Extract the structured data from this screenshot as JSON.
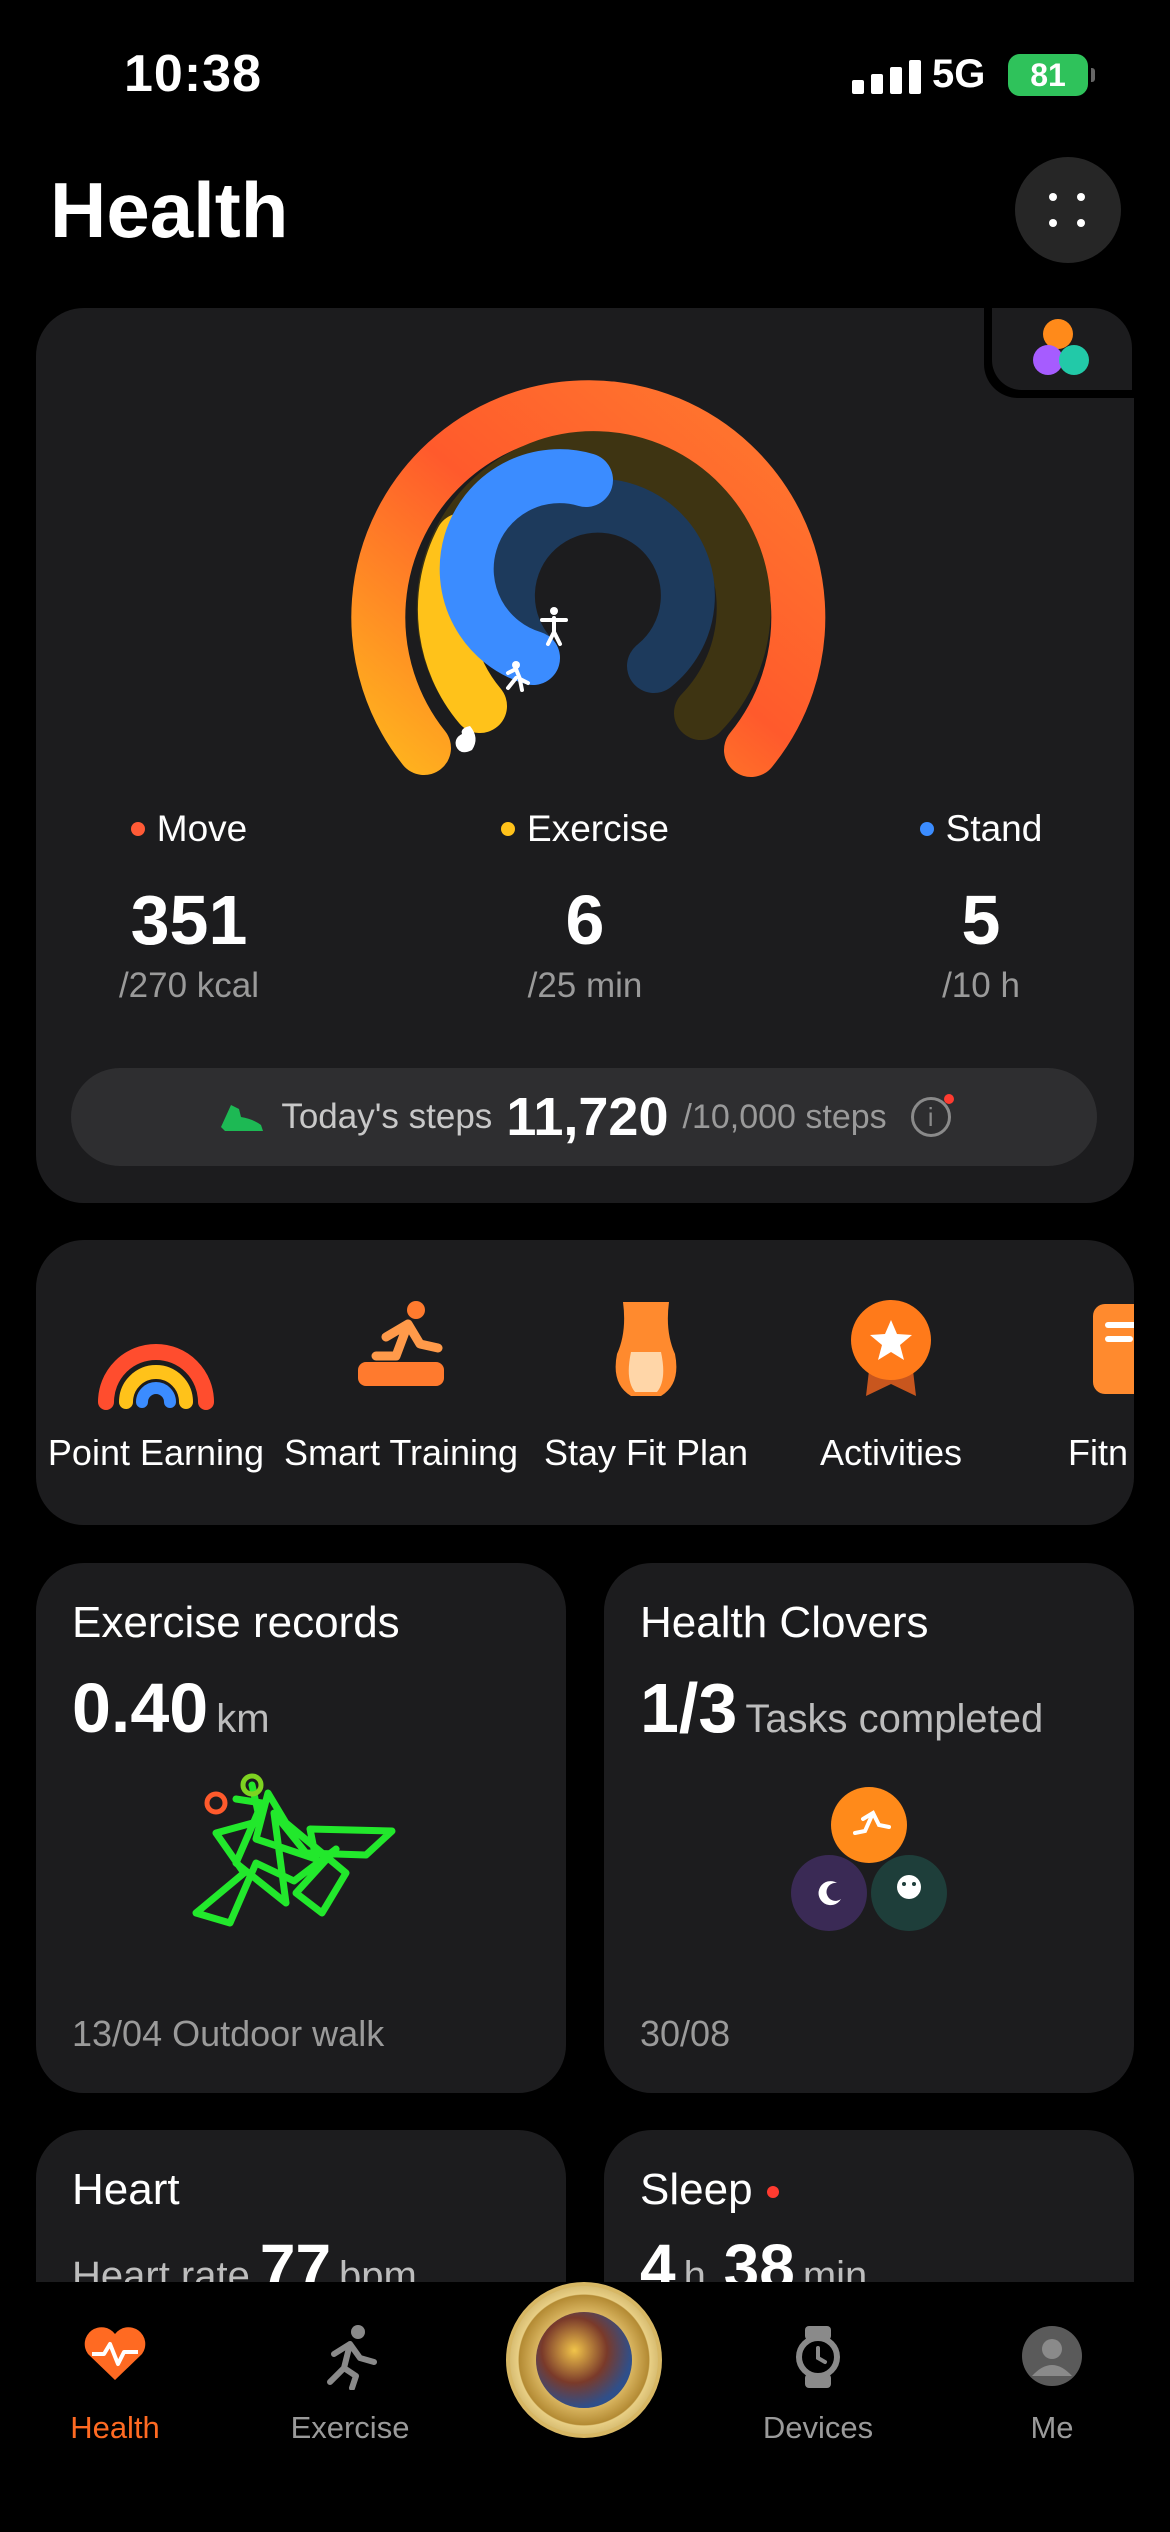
{
  "status_bar": {
    "time": "10:38",
    "network": "5G",
    "battery": "81"
  },
  "header": {
    "title": "Health"
  },
  "rings": {
    "metrics": [
      {
        "label": "Move",
        "value": "351",
        "goal": "/270 kcal",
        "color": "#ff5a36"
      },
      {
        "label": "Exercise",
        "value": "6",
        "goal": "/25 min",
        "color": "#ffc21a"
      },
      {
        "label": "Stand",
        "value": "5",
        "goal": "/10 h",
        "color": "#3b8cff"
      }
    ],
    "move_progress": 1.0,
    "exercise_progress": 0.24,
    "stand_progress": 0.5,
    "steps_label": "Today's steps",
    "steps_value": "11,720",
    "steps_goal": "/10,000 steps"
  },
  "shortcuts": [
    {
      "label": "Point Earning",
      "icon": "rainbow-icon"
    },
    {
      "label": "Smart Training",
      "icon": "runner-icon"
    },
    {
      "label": "Stay Fit Plan",
      "icon": "body-icon"
    },
    {
      "label": "Activities",
      "icon": "star-medal-icon"
    },
    {
      "label": "Fitn Cou",
      "icon": "course-icon"
    }
  ],
  "tiles": {
    "exercise": {
      "title": "Exercise records",
      "value": "0.40",
      "unit": "km",
      "footer": "13/04 Outdoor walk"
    },
    "clovers": {
      "title": "Health Clovers",
      "value": "1/3",
      "unit": "Tasks completed",
      "footer": "30/08"
    },
    "heart": {
      "title": "Heart",
      "sub": "Heart rate",
      "value": "77",
      "unit": "bpm"
    },
    "sleep": {
      "title": "Sleep",
      "value": "4",
      "unit1": "h",
      "value2": "38",
      "unit2": "min"
    }
  },
  "bottom_nav": {
    "items": [
      {
        "label": "Health",
        "active": true
      },
      {
        "label": "Exercise",
        "active": false
      },
      {
        "label": "Devices",
        "active": false
      },
      {
        "label": "Me",
        "active": false
      }
    ],
    "accent": "#ff6a22"
  }
}
